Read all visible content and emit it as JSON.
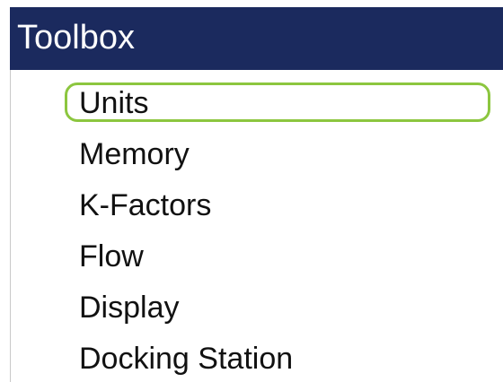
{
  "toolbox": {
    "title": "Toolbox",
    "header_color": "#1b2a5e",
    "selection_color": "#8cc63f",
    "selected_item": "Units",
    "items": [
      {
        "label": "Units"
      },
      {
        "label": "Memory"
      },
      {
        "label": "K-Factors"
      },
      {
        "label": "Flow"
      },
      {
        "label": "Display"
      },
      {
        "label": "Docking Station"
      }
    ]
  }
}
